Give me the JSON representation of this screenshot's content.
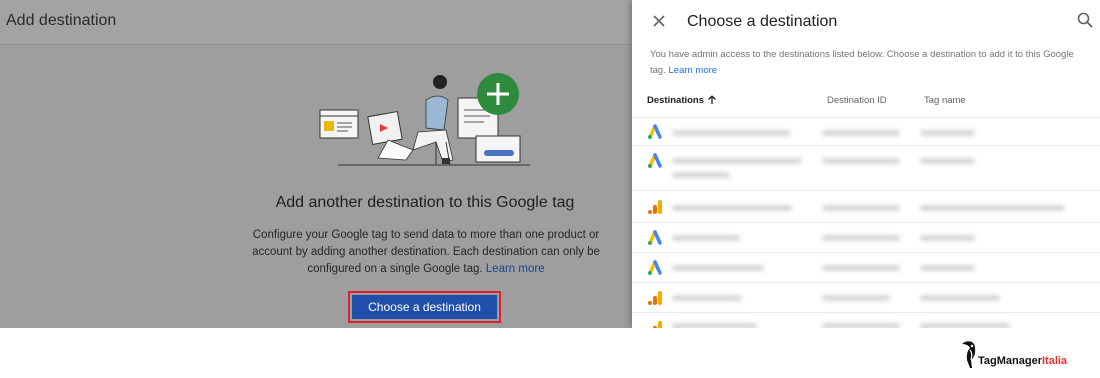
{
  "left": {
    "title": "Add destination",
    "headline": "Add another destination to this Google tag",
    "body": "Configure your Google tag to send data to more than one product or account by adding another destination. Each destination can only be configured on a single Google tag.",
    "learn_more": "Learn more",
    "cta_label": "Choose a destination"
  },
  "panel": {
    "title": "Choose a destination",
    "description": "You have admin access to the destinations listed below. Choose a destination to add it to this Google tag.",
    "learn_more": "Learn more",
    "columns": {
      "destinations": "Destinations",
      "destination_id": "Destination ID",
      "tag_name": "Tag name"
    },
    "rows": [
      {
        "icon": "google-ads-icon"
      },
      {
        "icon": "google-ads-icon"
      },
      {
        "icon": "google-analytics-icon"
      },
      {
        "icon": "google-ads-icon"
      },
      {
        "icon": "google-ads-icon"
      },
      {
        "icon": "google-analytics-icon"
      },
      {
        "icon": "google-analytics-icon"
      }
    ]
  },
  "watermark": {
    "brand": "TagManager",
    "brand_suffix": "Italia"
  },
  "colors": {
    "cta": "#1f4fa8",
    "cta_highlight": "#e0202a",
    "link": "#1a73e8",
    "ads_blue": "#4285f4",
    "ads_yellow": "#fbbc04",
    "ads_green": "#34a853",
    "analytics_orange": "#f9ab00",
    "analytics_dark": "#e37400"
  }
}
